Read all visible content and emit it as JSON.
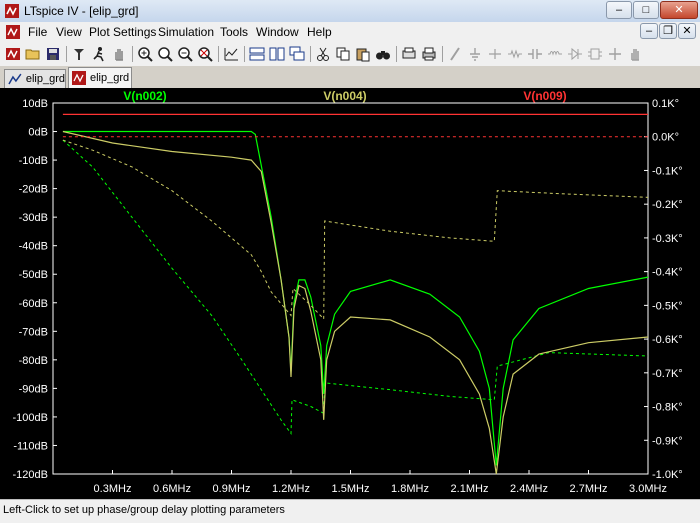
{
  "window": {
    "title": "LTspice IV - [elip_grd]"
  },
  "menu": [
    "File",
    "View",
    "Plot Settings",
    "Simulation",
    "Tools",
    "Window",
    "Help"
  ],
  "toolbar_icons": [
    "new-schematic-icon",
    "open-icon",
    "save-icon",
    "control-panel-icon",
    "run-icon",
    "halt-icon",
    "zoom-in-icon",
    "zoom-fit-icon",
    "zoom-out-icon",
    "zoom-cancel-icon",
    "autorange-icon",
    "tile-horizontal-icon",
    "tile-vertical-icon",
    "cascade-icon",
    "cut-icon",
    "copy-icon",
    "paste-icon",
    "find-icon",
    "print-preview-icon",
    "print-icon",
    "wire-icon",
    "ground-icon",
    "label-icon",
    "resistor-icon",
    "capacitor-icon",
    "inductor-icon",
    "diode-icon",
    "component-icon",
    "move-icon",
    "drag-icon"
  ],
  "tabs": [
    {
      "label": "elip_grd",
      "active": false
    },
    {
      "label": "elip_grd",
      "active": true
    }
  ],
  "status": "Left-Click to set up phase/group delay plotting parameters",
  "chart_data": {
    "type": "line",
    "xlabel": "",
    "x_ticks": [
      "0.3MHz",
      "0.6MHz",
      "0.9MHz",
      "1.2MHz",
      "1.5MHz",
      "1.8MHz",
      "2.1MHz",
      "2.4MHz",
      "2.7MHz",
      "3.0MHz"
    ],
    "xlim": [
      0.0,
      3.0
    ],
    "ylim_left": [
      -120,
      10
    ],
    "y_ticks_left": [
      "10dB",
      "0dB",
      "-10dB",
      "-20dB",
      "-30dB",
      "-40dB",
      "-50dB",
      "-60dB",
      "-70dB",
      "-80dB",
      "-90dB",
      "-100dB",
      "-110dB",
      "-120dB"
    ],
    "ylim_right": [
      -1.0,
      0.1
    ],
    "y_ticks_right": [
      "0.1K°",
      "0.0K°",
      "-0.1K°",
      "-0.2K°",
      "-0.3K°",
      "-0.4K°",
      "-0.5K°",
      "-0.6K°",
      "-0.7K°",
      "-0.8K°",
      "-0.9K°",
      "-1.0K°"
    ],
    "grid": false,
    "legend": "top",
    "series": [
      {
        "name": "V(n002)",
        "color": "#00ff00",
        "magnitude_db": [
          [
            0.05,
            0
          ],
          [
            0.5,
            0
          ],
          [
            1.0,
            0
          ],
          [
            1.02,
            -1
          ],
          [
            1.1,
            -30
          ],
          [
            1.15,
            -52
          ],
          [
            1.19,
            -72
          ],
          [
            1.2,
            -84
          ],
          [
            1.215,
            -60
          ],
          [
            1.24,
            -52
          ],
          [
            1.27,
            -52
          ],
          [
            1.3,
            -58
          ],
          [
            1.35,
            -75
          ],
          [
            1.365,
            -92
          ],
          [
            1.38,
            -75
          ],
          [
            1.42,
            -64
          ],
          [
            1.5,
            -56
          ],
          [
            1.7,
            -52
          ],
          [
            1.9,
            -57
          ],
          [
            2.05,
            -65
          ],
          [
            2.15,
            -77
          ],
          [
            2.2,
            -90
          ],
          [
            2.235,
            -117
          ],
          [
            2.27,
            -90
          ],
          [
            2.32,
            -73
          ],
          [
            2.45,
            -62
          ],
          [
            2.7,
            -55
          ],
          [
            3.0,
            -51
          ]
        ],
        "phase_k": [
          [
            0.05,
            -0.01
          ],
          [
            0.2,
            -0.09
          ],
          [
            0.4,
            -0.24
          ],
          [
            0.6,
            -0.39
          ],
          [
            0.8,
            -0.53
          ],
          [
            0.95,
            -0.66
          ],
          [
            1.05,
            -0.75
          ],
          [
            1.15,
            -0.84
          ],
          [
            1.2,
            -0.88
          ],
          [
            1.205,
            -0.78
          ],
          [
            1.3,
            -0.8
          ],
          [
            1.365,
            -0.82
          ],
          [
            1.37,
            -0.73
          ],
          [
            1.7,
            -0.75
          ],
          [
            2.0,
            -0.77
          ],
          [
            2.225,
            -0.78
          ],
          [
            2.24,
            -0.68
          ],
          [
            2.5,
            -0.64
          ],
          [
            3.0,
            -0.65
          ]
        ]
      },
      {
        "name": "V(n004)",
        "color": "#cccc66",
        "magnitude_db": [
          [
            0.05,
            0
          ],
          [
            0.3,
            -4
          ],
          [
            0.6,
            -7
          ],
          [
            0.9,
            -9
          ],
          [
            1.0,
            -10
          ],
          [
            1.05,
            -14
          ],
          [
            1.1,
            -32
          ],
          [
            1.15,
            -52
          ],
          [
            1.19,
            -72
          ],
          [
            1.2,
            -86
          ],
          [
            1.215,
            -62
          ],
          [
            1.24,
            -54
          ],
          [
            1.27,
            -55
          ],
          [
            1.3,
            -63
          ],
          [
            1.35,
            -80
          ],
          [
            1.365,
            -101
          ],
          [
            1.38,
            -80
          ],
          [
            1.42,
            -70
          ],
          [
            1.5,
            -65
          ],
          [
            1.7,
            -66
          ],
          [
            1.9,
            -72
          ],
          [
            2.05,
            -80
          ],
          [
            2.15,
            -92
          ],
          [
            2.2,
            -104
          ],
          [
            2.235,
            -120
          ],
          [
            2.27,
            -100
          ],
          [
            2.32,
            -85
          ],
          [
            2.45,
            -78
          ],
          [
            2.7,
            -74
          ],
          [
            3.0,
            -72
          ]
        ],
        "phase_k": [
          [
            0.05,
            -0.01
          ],
          [
            0.2,
            -0.04
          ],
          [
            0.4,
            -0.09
          ],
          [
            0.6,
            -0.16
          ],
          [
            0.8,
            -0.25
          ],
          [
            1.0,
            -0.35
          ],
          [
            1.05,
            -0.4
          ],
          [
            1.1,
            -0.46
          ],
          [
            1.2,
            -0.53
          ],
          [
            1.21,
            -0.45
          ],
          [
            1.3,
            -0.5
          ],
          [
            1.365,
            -0.54
          ],
          [
            1.37,
            -0.25
          ],
          [
            1.7,
            -0.28
          ],
          [
            2.0,
            -0.3
          ],
          [
            2.225,
            -0.31
          ],
          [
            2.24,
            -0.16
          ],
          [
            2.6,
            -0.17
          ],
          [
            3.0,
            -0.18
          ]
        ]
      },
      {
        "name": "V(n009)",
        "color": "#ff3333",
        "magnitude_db": [
          [
            0.05,
            6
          ],
          [
            3.0,
            6
          ]
        ],
        "phase_k": [
          [
            0.05,
            0.0
          ],
          [
            3.0,
            0.0
          ]
        ]
      }
    ]
  }
}
